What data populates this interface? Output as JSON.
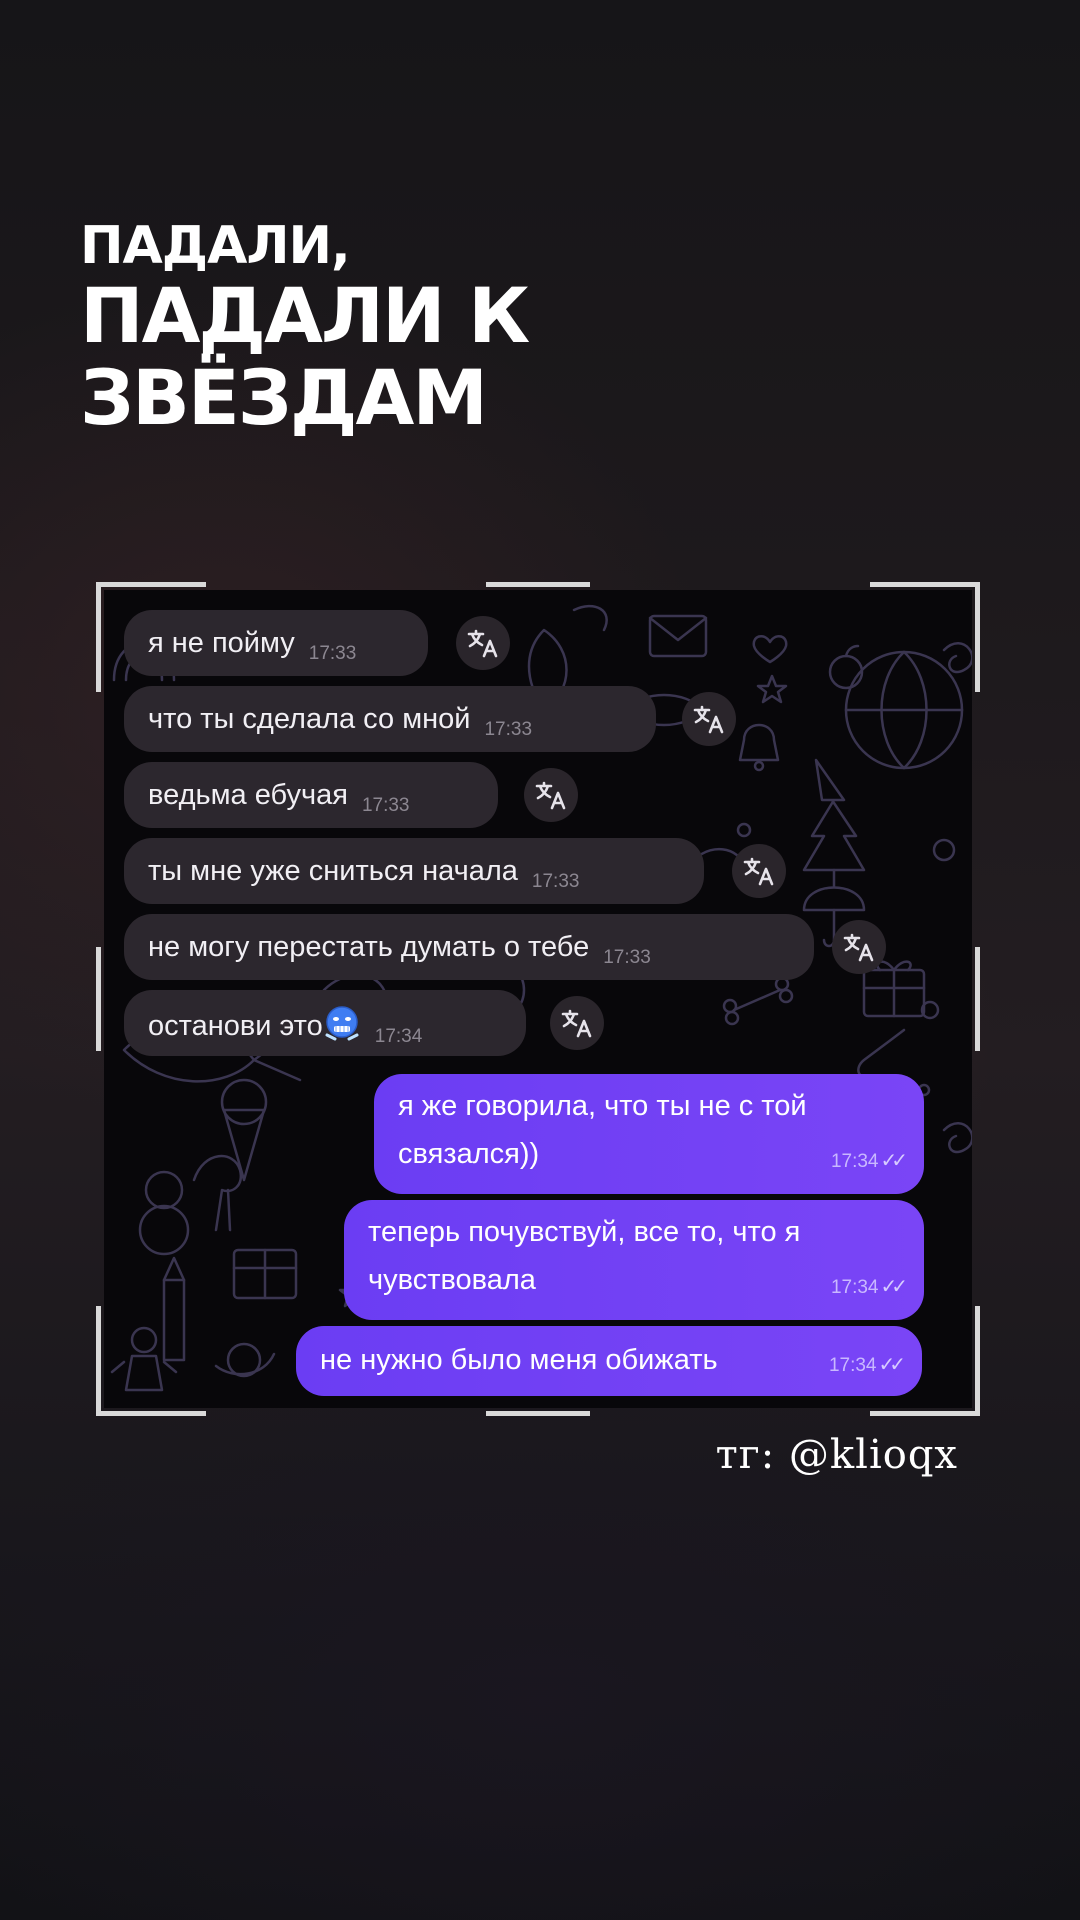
{
  "headline": {
    "line1": "ПАДАЛИ,",
    "line2": "ПАДАЛИ К",
    "line3": "ЗВЁЗДАМ"
  },
  "chat": {
    "incoming": [
      {
        "text": "я не пойму",
        "time": "17:33"
      },
      {
        "text": "что ты сделала со мной",
        "time": "17:33"
      },
      {
        "text": "ведьма ебучая",
        "time": "17:33"
      },
      {
        "text": "ты мне уже сниться начала",
        "time": "17:33"
      },
      {
        "text": "не могу перестать думать о тебе",
        "time": "17:33"
      },
      {
        "text": "останови это",
        "time": "17:34",
        "emoji": "cold-face-emoji"
      }
    ],
    "outgoing": [
      {
        "line1": "я же говорила, что ты не с той",
        "line2": "связался))",
        "time": "17:34",
        "status": "read"
      },
      {
        "line1": "теперь почувствуй, все то, что я",
        "line2": "чувствовала",
        "time": "17:34",
        "status": "read"
      },
      {
        "text": "не нужно было меня обижать",
        "time": "17:34",
        "status": "read"
      }
    ],
    "translate_icon": "translate-icon",
    "read_ticks": "✓✓"
  },
  "watermark": "тг: @klioqx",
  "colors": {
    "background": "#1c191c",
    "incoming_bubble": "#2c272e",
    "outgoing_bubble": "#7040f5",
    "frame_corners": "#d9d9d9"
  }
}
